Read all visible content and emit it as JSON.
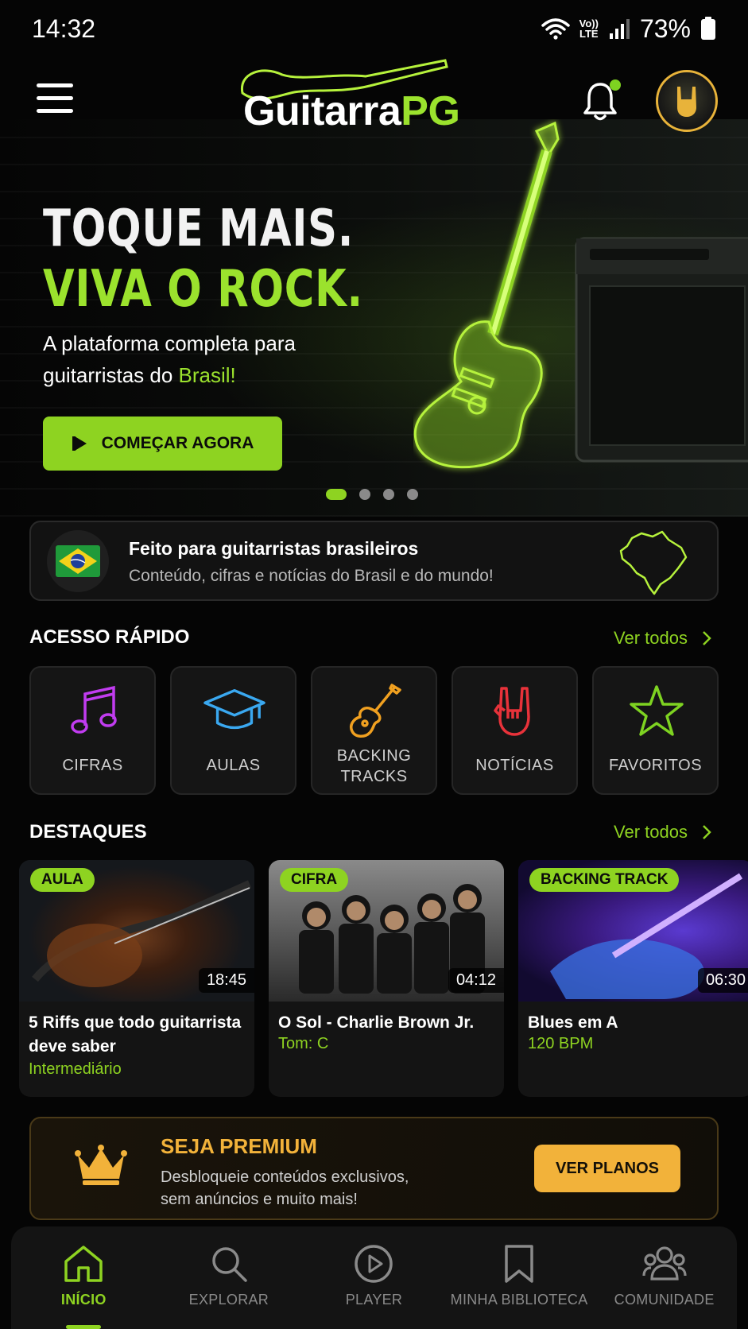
{
  "status_bar": {
    "time": "14:32",
    "volte_top": "Vo))",
    "volte_bottom": "LTE",
    "battery": "73%"
  },
  "header": {
    "logo_part1": "Guitarra",
    "logo_part2": "PG",
    "has_notification": true
  },
  "hero": {
    "title_line1": "TOQUE MAIS.",
    "title_line2": "VIVA O ROCK.",
    "subtitle_line1": "A plataforma completa para",
    "subtitle_line2_prefix": "guitarristas do ",
    "subtitle_highlight": "Brasil!",
    "cta_label": "COMEÇAR AGORA",
    "slide_count": 4,
    "active_slide": 1
  },
  "brasil_banner": {
    "title": "Feito para guitarristas brasileiros",
    "subtitle": "Conteúdo, cifras e notícias do Brasil e do mundo!"
  },
  "quick_access": {
    "title": "ACESSO RÁPIDO",
    "see_all": "Ver todos",
    "items": [
      {
        "label": "CIFRAS",
        "icon": "music-note-icon",
        "color": "#c13cf0"
      },
      {
        "label": "AULAS",
        "icon": "graduation-cap-icon",
        "color": "#3aa8f0"
      },
      {
        "label": "BACKING TRACKS",
        "label_line1": "BACKING",
        "label_line2": "TRACKS",
        "icon": "guitar-icon",
        "color": "#f0a020"
      },
      {
        "label": "NOTÍCIAS",
        "icon": "rock-hand-icon",
        "color": "#e8323a"
      },
      {
        "label": "FAVORITOS",
        "icon": "star-icon",
        "color": "#7ed321"
      }
    ]
  },
  "highlights": {
    "title": "DESTAQUES",
    "see_all": "Ver todos",
    "cards": [
      {
        "tag": "AULA",
        "duration": "18:45",
        "title": "5 Riffs que todo guitarrista deve saber",
        "meta": "Intermediário"
      },
      {
        "tag": "CIFRA",
        "duration": "04:12",
        "title": "O Sol - Charlie Brown Jr.",
        "meta": "Tom: C"
      },
      {
        "tag": "BACKING TRACK",
        "duration": "06:30",
        "title": "Blues em A",
        "meta": "120 BPM"
      }
    ]
  },
  "premium": {
    "title": "SEJA PREMIUM",
    "subtitle_line1": "Desbloqueie conteúdos exclusivos,",
    "subtitle_line2": "sem anúncios e muito mais!",
    "button": "VER PLANOS"
  },
  "bottom_nav": {
    "items": [
      {
        "label": "INÍCIO",
        "icon": "home-icon",
        "active": true
      },
      {
        "label": "EXPLORAR",
        "icon": "search-icon",
        "active": false
      },
      {
        "label": "PLAYER",
        "icon": "play-circle-icon",
        "active": false
      },
      {
        "label": "MINHA BIBLIOTECA",
        "icon": "bookmark-icon",
        "active": false
      },
      {
        "label": "COMUNIDADE",
        "icon": "community-icon",
        "active": false
      }
    ]
  },
  "colors": {
    "accent": "#8ed321",
    "premium": "#f2b23a",
    "background": "#050505"
  }
}
